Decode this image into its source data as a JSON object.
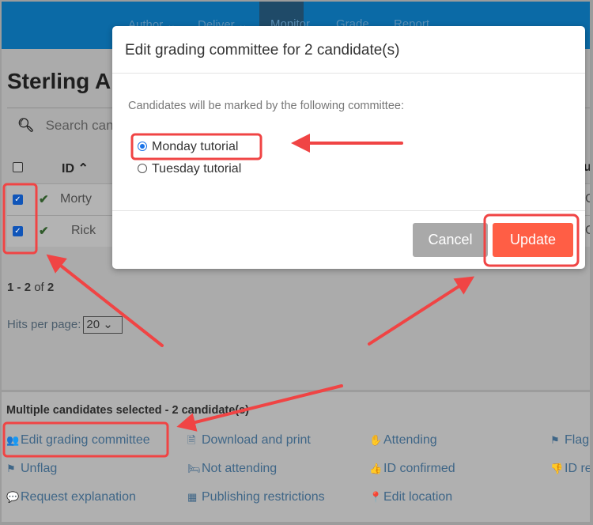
{
  "nav": {
    "items": [
      "Author ⌄",
      "Deliver ⌄",
      "Monitor",
      "Grade",
      "Report"
    ],
    "active": "Monitor"
  },
  "page": {
    "title": "Sterling A",
    "search_placeholder": "Search can",
    "id_header": "ID ⌃",
    "right_header": "u",
    "rows": [
      {
        "name": "Morty",
        "checked": true,
        "status": "✔",
        "cut": "C"
      },
      {
        "name": "Rick",
        "checked": true,
        "status": "✔",
        "cut": "C"
      }
    ],
    "pager": {
      "from": "1",
      "sep": " - ",
      "to": "2",
      "of": " of ",
      "total": "2"
    },
    "hits_label": "Hits per page:",
    "hits_value": "20"
  },
  "bottom": {
    "title": "Multiple candidates selected - 2 candidate(s)",
    "actions": [
      {
        "label": "Edit grading committee",
        "icon": "users-icon",
        "glyph": "👥"
      },
      {
        "label": "Download and print",
        "icon": "document-icon",
        "glyph": "🗎"
      },
      {
        "label": "Attending",
        "icon": "hand-icon",
        "glyph": "✋"
      },
      {
        "label": "Flag",
        "icon": "flag-icon",
        "glyph": "⚑"
      },
      {
        "label": "Unflag",
        "icon": "flag-icon",
        "glyph": "⚑"
      },
      {
        "label": "Not attending",
        "icon": "bed-icon",
        "glyph": "🛏"
      },
      {
        "label": "ID confirmed",
        "icon": "thumbs-up-icon",
        "glyph": "👍"
      },
      {
        "label": "ID re",
        "icon": "thumbs-down-icon",
        "glyph": "👎"
      },
      {
        "label": "Request explanation",
        "icon": "comment-icon",
        "glyph": "💬"
      },
      {
        "label": "Publishing restrictions",
        "icon": "calendar-icon",
        "glyph": "▦"
      },
      {
        "label": "Edit location",
        "icon": "map-marker-icon",
        "glyph": "📍"
      }
    ]
  },
  "modal": {
    "title": "Edit grading committee for 2 candidate(s)",
    "intro": "Candidates will be marked by the following committee:",
    "options": [
      {
        "label": "Monday tutorial",
        "selected": true
      },
      {
        "label": "Tuesday tutorial",
        "selected": false
      }
    ],
    "cancel": "Cancel",
    "update": "Update"
  },
  "colors": {
    "nav": "#0b6aa6",
    "update": "#ff5e45",
    "annotation": "#f04444",
    "link": "#3f6687"
  }
}
